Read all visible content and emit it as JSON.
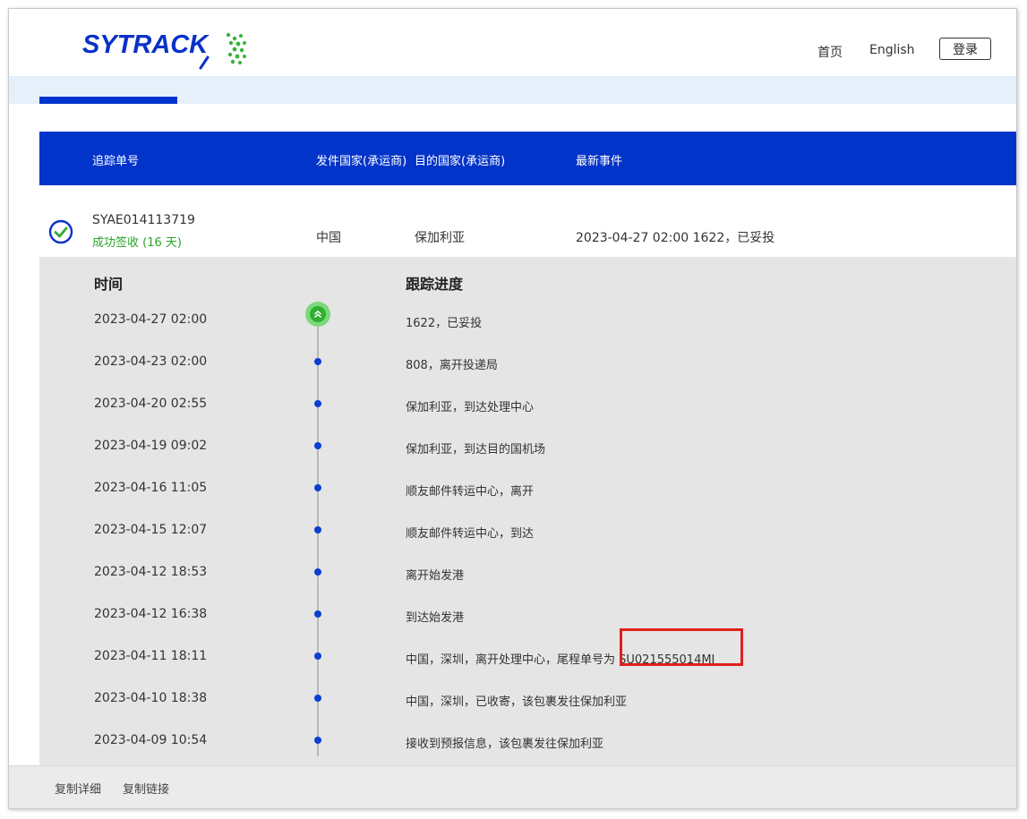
{
  "header": {
    "logo_text": "SYTRACK",
    "nav_home": "首页",
    "nav_english": "English",
    "login_label": "登录"
  },
  "table": {
    "headers": [
      "追踪单号",
      "发件国家(承运商)",
      "目的国家(承运商)",
      "最新事件"
    ],
    "row": {
      "tracking_number": "SYAE014113719",
      "status": "成功签收 (16 天)",
      "origin": "中国",
      "destination": "保加利亚",
      "latest_event": "2023-04-27 02:00 1622，已妥投"
    }
  },
  "details": {
    "time_header": "时间",
    "progress_header": "跟踪进度",
    "events": [
      {
        "time": "2023-04-27 02:00",
        "desc": "1622，已妥投"
      },
      {
        "time": "2023-04-23 02:00",
        "desc": "808，离开投递局"
      },
      {
        "time": "2023-04-20 02:55",
        "desc": "保加利亚，到达处理中心"
      },
      {
        "time": "2023-04-19 09:02",
        "desc": "保加利亚，到达目的国机场"
      },
      {
        "time": "2023-04-16 11:05",
        "desc": "顺友邮件转运中心，离开"
      },
      {
        "time": "2023-04-15 12:07",
        "desc": "顺友邮件转运中心，到达"
      },
      {
        "time": "2023-04-12 18:53",
        "desc": "离开始发港"
      },
      {
        "time": "2023-04-12 16:38",
        "desc": "到达始发港"
      },
      {
        "time": "2023-04-11 18:11",
        "desc": "中国，深圳，离开处理中心，尾程单号为 SU021555014MI"
      },
      {
        "time": "2023-04-10 18:38",
        "desc": "中国，深圳，已收寄，该包裹发往保加利亚"
      },
      {
        "time": "2023-04-09 10:54",
        "desc": "接收到预报信息，该包裹发往保加利亚"
      }
    ]
  },
  "footer": {
    "copy_details": "复制详细",
    "copy_link": "复制链接"
  },
  "colors": {
    "brand_blue": "#0234c9",
    "success_green": "#2fae2f",
    "highlight_red": "#e0201b"
  }
}
